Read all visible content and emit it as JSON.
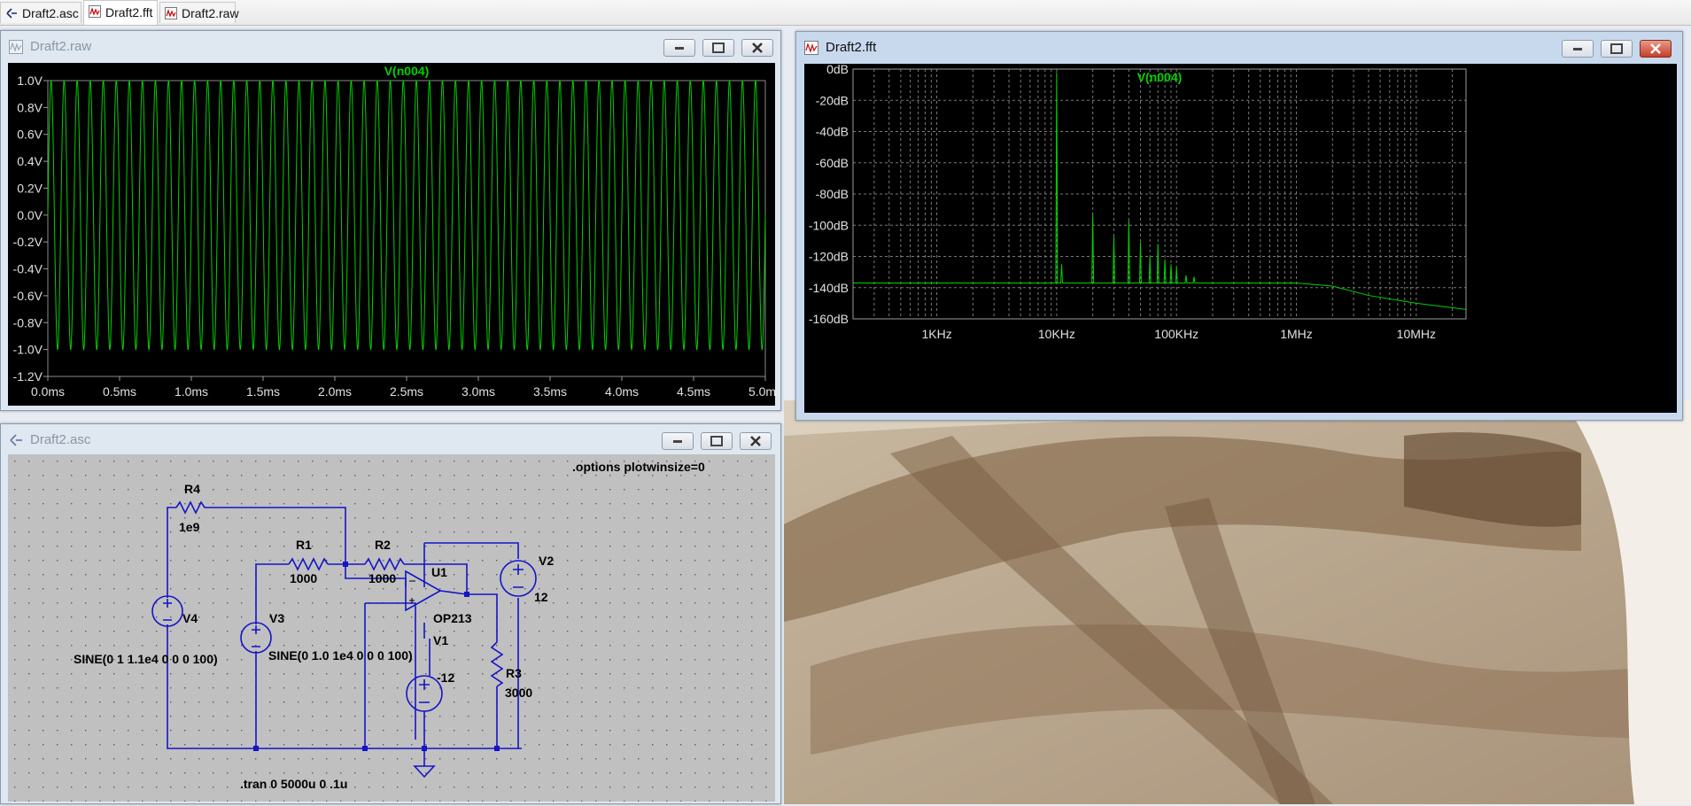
{
  "tabs": [
    {
      "label": "Draft2.asc"
    },
    {
      "label": "Draft2.fft"
    },
    {
      "label": "Draft2.raw"
    }
  ],
  "raw_window": {
    "title": "Draft2.raw",
    "chart_data": {
      "type": "line",
      "title": "V(n004)",
      "yticks": [
        "1.0V",
        "0.8V",
        "0.6V",
        "0.4V",
        "0.2V",
        "0.0V",
        "-0.2V",
        "-0.4V",
        "-0.6V",
        "-0.8V",
        "-1.0V",
        "-1.2V"
      ],
      "xticks": [
        "0.0ms",
        "0.5ms",
        "1.0ms",
        "1.5ms",
        "2.0ms",
        "2.5ms",
        "3.0ms",
        "3.5ms",
        "4.0ms",
        "4.5ms",
        "5.0ms"
      ],
      "xlim_ms": [
        0,
        5
      ],
      "ylim_v": [
        -1.2,
        1.0
      ],
      "series": [
        {
          "amplitude_v": 1.0,
          "offset_v": 0.0,
          "frequency_hz": 11000,
          "color": "#00d000"
        }
      ],
      "grid": false
    }
  },
  "fft_window": {
    "title": "Draft2.fft",
    "chart_data": {
      "type": "line",
      "title": "V(n004)",
      "yticks": [
        "0dB",
        "-20dB",
        "-40dB",
        "-60dB",
        "-80dB",
        "-100dB",
        "-120dB",
        "-140dB",
        "-160dB"
      ],
      "xticks": [
        "1KHz",
        "10KHz",
        "100KHz",
        "1MHz",
        "10MHz"
      ],
      "xscale": "log",
      "xlim_hz": [
        200,
        26000000
      ],
      "ylim_db": [
        -160,
        0
      ],
      "noise_floor_db": -137,
      "peaks": [
        {
          "f_hz": 10000,
          "db": -2
        },
        {
          "f_hz": 11000,
          "db": -125
        },
        {
          "f_hz": 20000,
          "db": -93
        },
        {
          "f_hz": 30000,
          "db": -107
        },
        {
          "f_hz": 40000,
          "db": -97
        },
        {
          "f_hz": 50000,
          "db": -111
        },
        {
          "f_hz": 60000,
          "db": -120
        },
        {
          "f_hz": 70000,
          "db": -112
        },
        {
          "f_hz": 80000,
          "db": -122
        },
        {
          "f_hz": 90000,
          "db": -125
        },
        {
          "f_hz": 100000,
          "db": -127
        },
        {
          "f_hz": 120000,
          "db": -132
        },
        {
          "f_hz": 140000,
          "db": -133
        }
      ],
      "rolloff": [
        {
          "f_hz": 1000000,
          "db": -137
        },
        {
          "f_hz": 2000000,
          "db": -139
        },
        {
          "f_hz": 4000000,
          "db": -145
        },
        {
          "f_hz": 10000000,
          "db": -150
        },
        {
          "f_hz": 26000000,
          "db": -154
        }
      ],
      "grid": true,
      "color": "#00d000"
    }
  },
  "asc_window": {
    "title": "Draft2.asc",
    "directives": {
      "options": ".options plotwinsize=0",
      "tran": ".tran 0 5000u 0 .1u"
    },
    "components": {
      "R4": {
        "name": "R4",
        "value": "1e9"
      },
      "R1": {
        "name": "R1",
        "value": "1000"
      },
      "R2": {
        "name": "R2",
        "value": "1000"
      },
      "U1": {
        "name": "U1",
        "value": "OP213"
      },
      "V2": {
        "name": "V2",
        "value": "12"
      },
      "V1": {
        "name": "V1",
        "value": "-12"
      },
      "V3": {
        "name": "V3",
        "value": "SINE(0 1.0 1e4 0 0 0 100)"
      },
      "V4": {
        "name": "V4",
        "value": "SINE(0 1 1.1e4 0 0 0 100)"
      },
      "R3": {
        "name": "R3",
        "value": "3000"
      }
    }
  },
  "colors": {
    "trace": "#00d000",
    "wire": "#1414c8",
    "schematic_bg": "#c0c0c0",
    "plot_bg": "#000000"
  }
}
